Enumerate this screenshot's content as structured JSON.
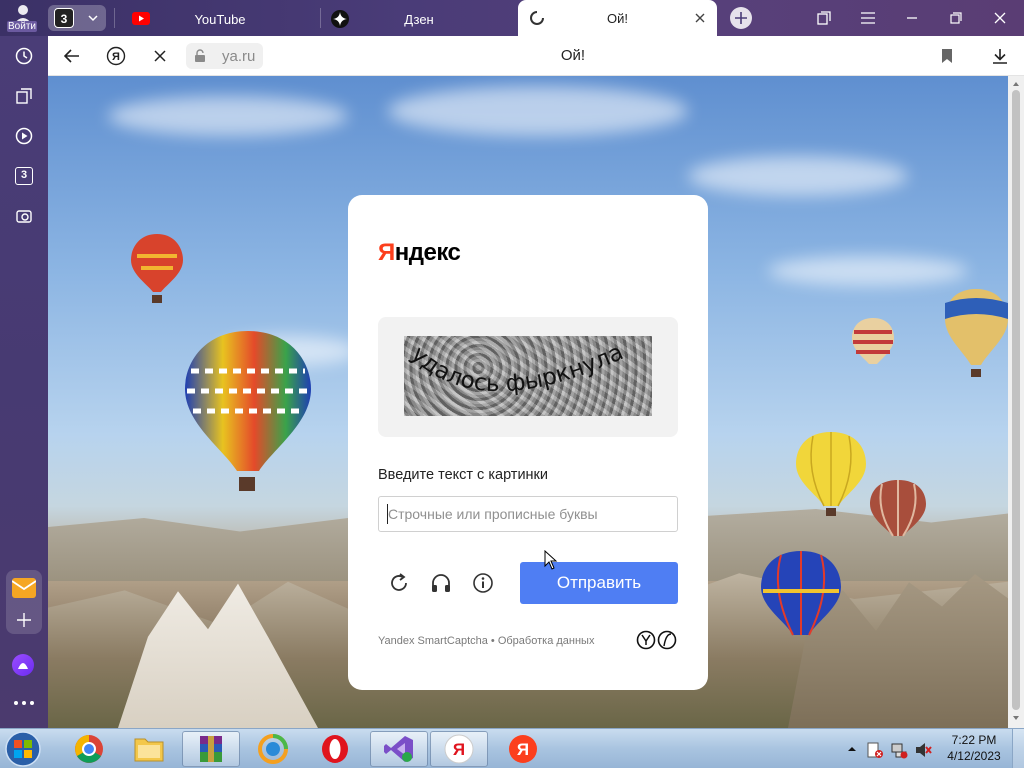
{
  "browser": {
    "profile_label": "Войти",
    "tab_group_count": "3",
    "tabs": [
      {
        "title": "YouTube",
        "icon": "youtube-icon",
        "active": false
      },
      {
        "title": "Дзен",
        "icon": "dzen-icon",
        "active": false
      },
      {
        "title": "Ой!",
        "icon": "loading-spinner-icon",
        "active": true
      }
    ],
    "sidebar_badge": "3",
    "address": {
      "url": "ya.ru",
      "page_title": "Ой!"
    }
  },
  "captcha": {
    "logo_first_letter": "Я",
    "logo_rest": "ндекс",
    "captcha_words": "удалось фыркнула",
    "prompt": "Введите текст с картинки",
    "input_placeholder": "Строчные или прописные буквы",
    "input_value": "",
    "submit_label": "Отправить",
    "footer_brand": "Yandex SmartCaptcha",
    "footer_separator": " • ",
    "footer_link": "Обработка данных"
  },
  "taskbar": {
    "apps": [
      "chrome-icon",
      "file-explorer-icon",
      "winrar-icon",
      "app-icon",
      "opera-icon",
      "visual-studio-icon",
      "yandex-browser-icon",
      "yandex-icon"
    ],
    "time": "7:22 PM",
    "date": "4/12/2023"
  },
  "colors": {
    "accent": "#4f7ef3",
    "yandex_red": "#fc3f1d",
    "chrome_purple": "#473a72"
  }
}
